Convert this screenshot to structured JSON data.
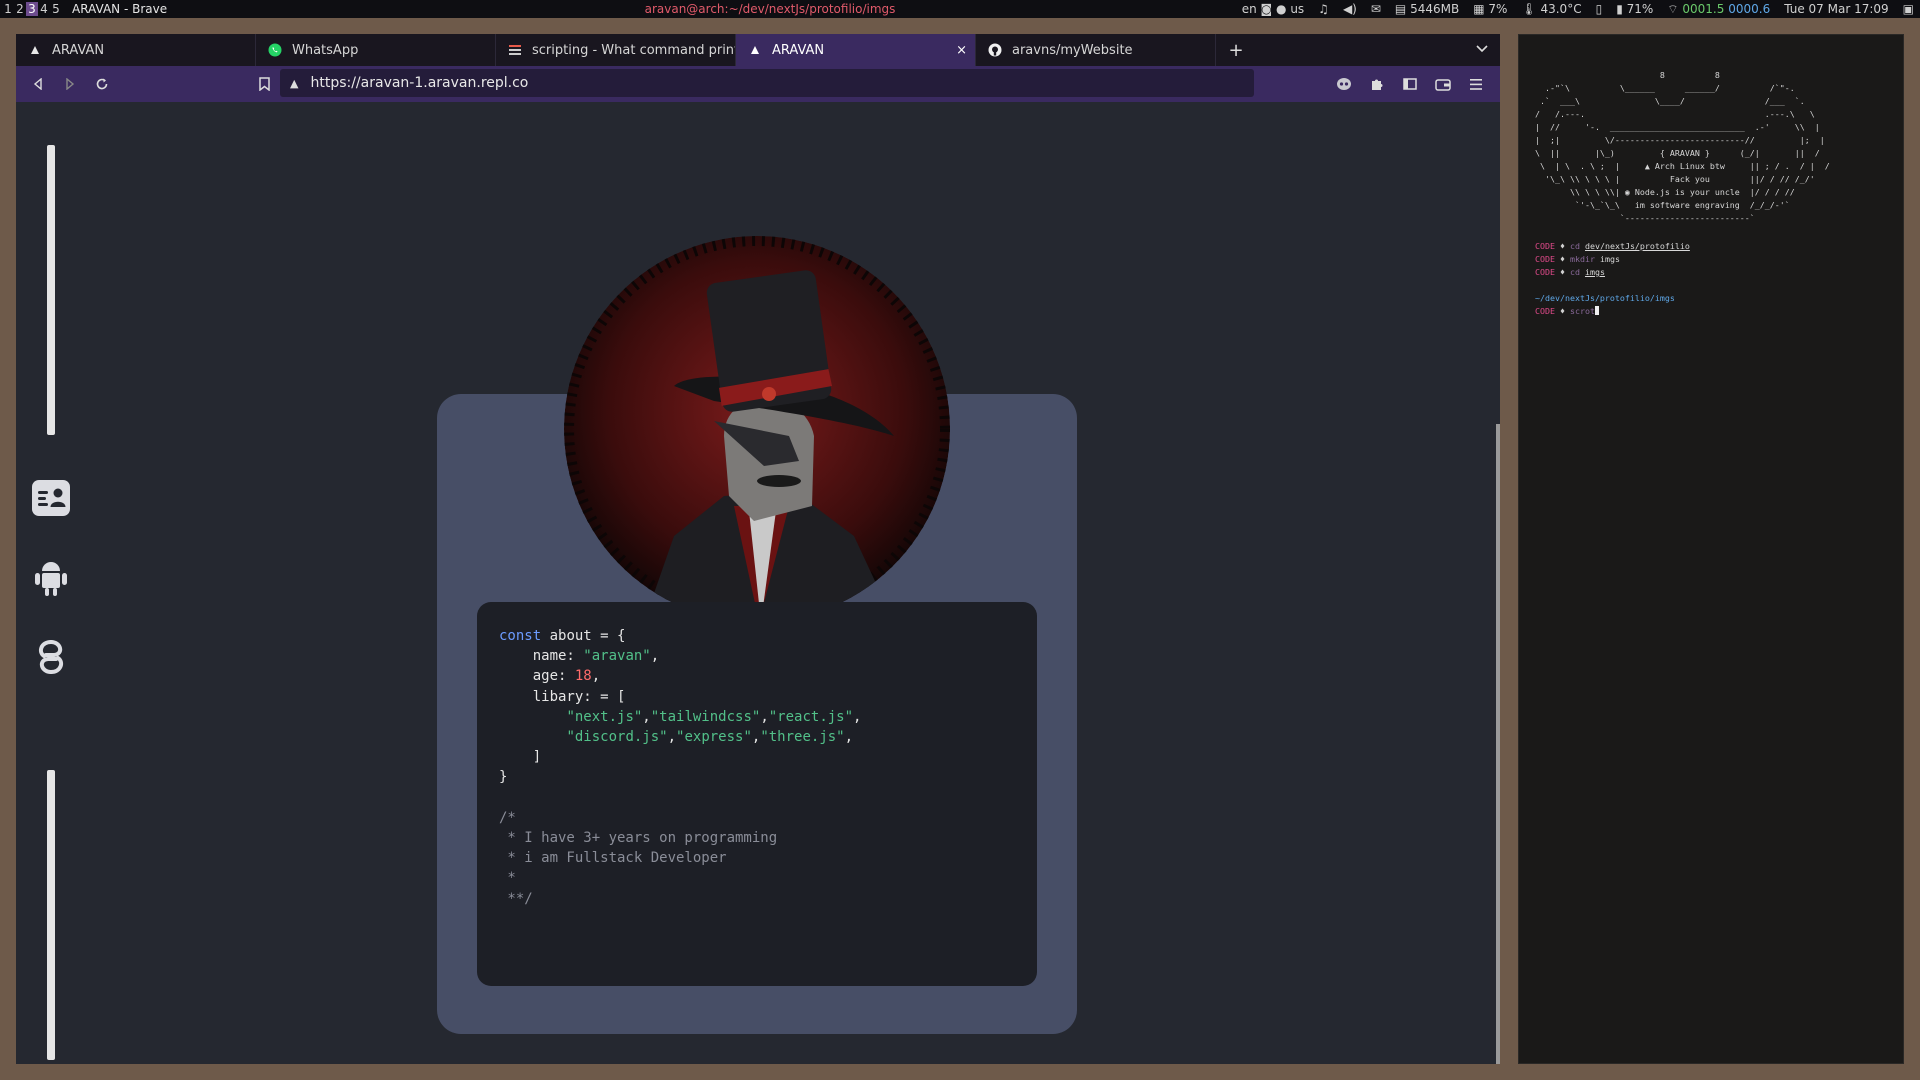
{
  "topbar": {
    "workspaces": [
      "1",
      "2",
      "3",
      "4",
      "5"
    ],
    "active_workspace": "3",
    "window_title": "ARAVAN - Brave",
    "terminal_title": "aravan@arch:~/dev/nextJs/protofilio/imgs",
    "status": {
      "lang": "en",
      "layout": "us",
      "memory": "5446MB",
      "cpu": "7%",
      "temperature": "43.0°C",
      "battery": "71%",
      "net_down": "0001.5",
      "net_up": "0000.6",
      "datetime": "Tue 07 Mar 17:09"
    }
  },
  "browser": {
    "tabs": [
      {
        "label": "ARAVAN",
        "icon": "aravan-logo-icon",
        "active": false
      },
      {
        "label": "WhatsApp",
        "icon": "whatsapp-icon",
        "active": false
      },
      {
        "label": "scripting - What command prints",
        "icon": "stackoverflow-icon",
        "active": false
      },
      {
        "label": "ARAVAN",
        "icon": "aravan-logo-icon",
        "active": true
      },
      {
        "label": "aravns/myWebsite",
        "icon": "github-icon",
        "active": false
      }
    ],
    "close_glyph": "×",
    "new_tab_glyph": "+",
    "url": "https://aravan-1.aravan.repl.co"
  },
  "page": {
    "code_lines": {
      "l1_kw": "const",
      "l1_rest": " about = {",
      "l2_key": "    name: ",
      "l2_val": "\"aravan\"",
      "l2_end": ",",
      "l3_key": "    age: ",
      "l3_val": "18",
      "l3_end": ",",
      "l4": "    libary: = [",
      "l5_a": "\"next.js\"",
      "l5_b": "\"tailwindcss\"",
      "l5_c": "\"react.js\"",
      "l6_a": "\"discord.js\"",
      "l6_b": "\"express\"",
      "l6_c": "\"three.js\"",
      "l7": "    ]",
      "l8": "}",
      "c1": "/*",
      "c2": " * I have 3+ years on programming",
      "c3": " * i am Fullstack Developer",
      "c4": " *",
      "c5": " **/"
    }
  },
  "terminal": {
    "ascii_art": "                         8          8\n  .-\"`\\          \\______      ______/          /`\"-.\n .`  ___\\               \\____/                /___  `.\n/   /.---.                                    .---.\\   \\\n|  //     '-.  ___________________________  .-'     \\\\  |\n|  ;|         \\/--------------------------//         |;  |\n\\  ||       |\\_)         { ARAVAN }      (_/|       ||  /\n \\  | \\  . \\ ;  |     ▲ Arch Linux btw     || ; / .  / |  /\n  '\\_\\ \\\\ \\ \\ \\ |          Fack you        ||/ / // /_/'\n       \\\\ \\ \\ \\\\| ◉ Node.js is your uncle  |/ / / //\n        `'-\\_`\\_\\   im software engraving  /_/_/-'`\n                 `-------------------------`",
    "lines": [
      {
        "prompt": "CODE",
        "cmd": "cd",
        "arg": "dev/nextJs/protofilio"
      },
      {
        "prompt": "CODE",
        "cmd": "mkdir",
        "arg": "imgs"
      },
      {
        "prompt": "CODE",
        "cmd": "cd",
        "arg": "imgs"
      }
    ],
    "cwd": "~/dev/nextJs/protofilio/imgs",
    "current_prompt": "CODE",
    "current_input": "scrot"
  }
}
